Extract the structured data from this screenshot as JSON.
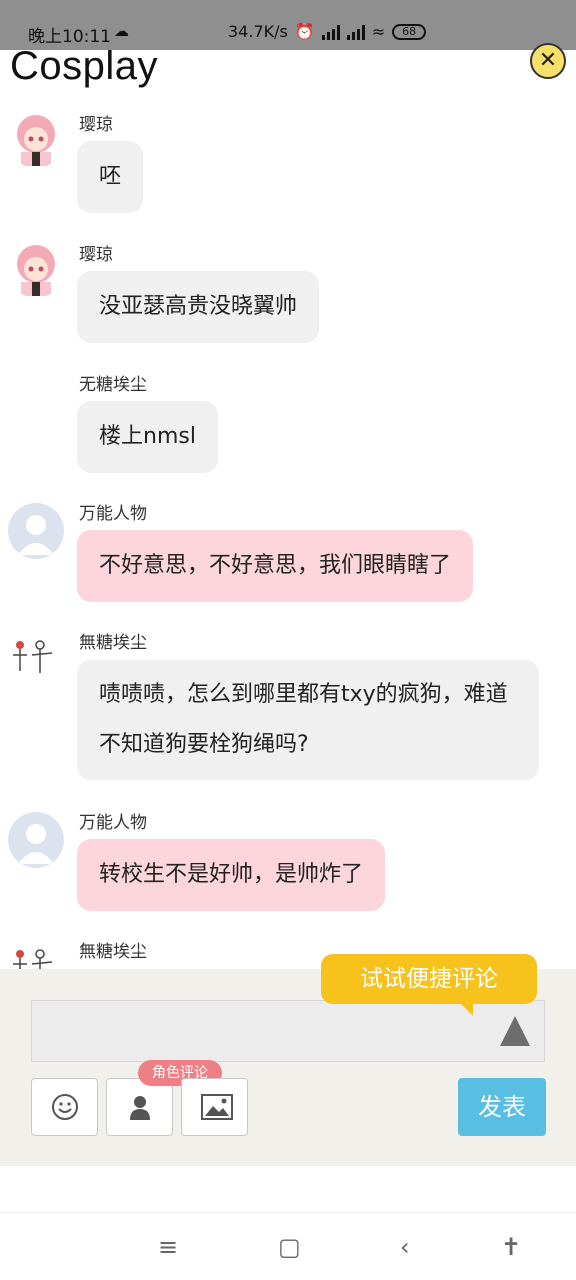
{
  "status_bar": {
    "time": "晚上10:11",
    "speed": "34.7K/s",
    "battery": "68"
  },
  "header": {
    "title": "Cosplay"
  },
  "messages": [
    {
      "name": "璎琼",
      "text": "呸",
      "style": "gray",
      "avatar": "anime"
    },
    {
      "name": "璎琼",
      "text": "没亚瑟高贵没晓翼帅",
      "style": "gray",
      "avatar": "anime"
    },
    {
      "name": "无糖埃尘",
      "text": "楼上nmsl",
      "style": "gray",
      "avatar": "none"
    },
    {
      "name": "万能人物",
      "text": "不好意思，不好意思，我们眼睛瞎了",
      "style": "pink",
      "avatar": "generic"
    },
    {
      "name": "無糖埃尘",
      "text": "啧啧啧，怎么到哪里都有txy的疯狗，难道不知道狗要栓狗绳吗?",
      "style": "gray",
      "avatar": "sketch"
    },
    {
      "name": "万能人物",
      "text": "转校生不是好帅，是帅炸了",
      "style": "pink",
      "avatar": "generic"
    },
    {
      "name": "無糖埃尘",
      "text": "",
      "style": "gray",
      "avatar": "sketch"
    }
  ],
  "composer": {
    "tooltip": "试试便捷评论",
    "role_badge": "角色评论",
    "send_label": "发表",
    "input_placeholder": ""
  },
  "colors": {
    "pink_bubble": "#fcd6dc",
    "gray_bubble": "#f0f0f0",
    "tooltip": "#f7c21c",
    "send": "#58bfe2",
    "badge": "#ef7f86"
  }
}
